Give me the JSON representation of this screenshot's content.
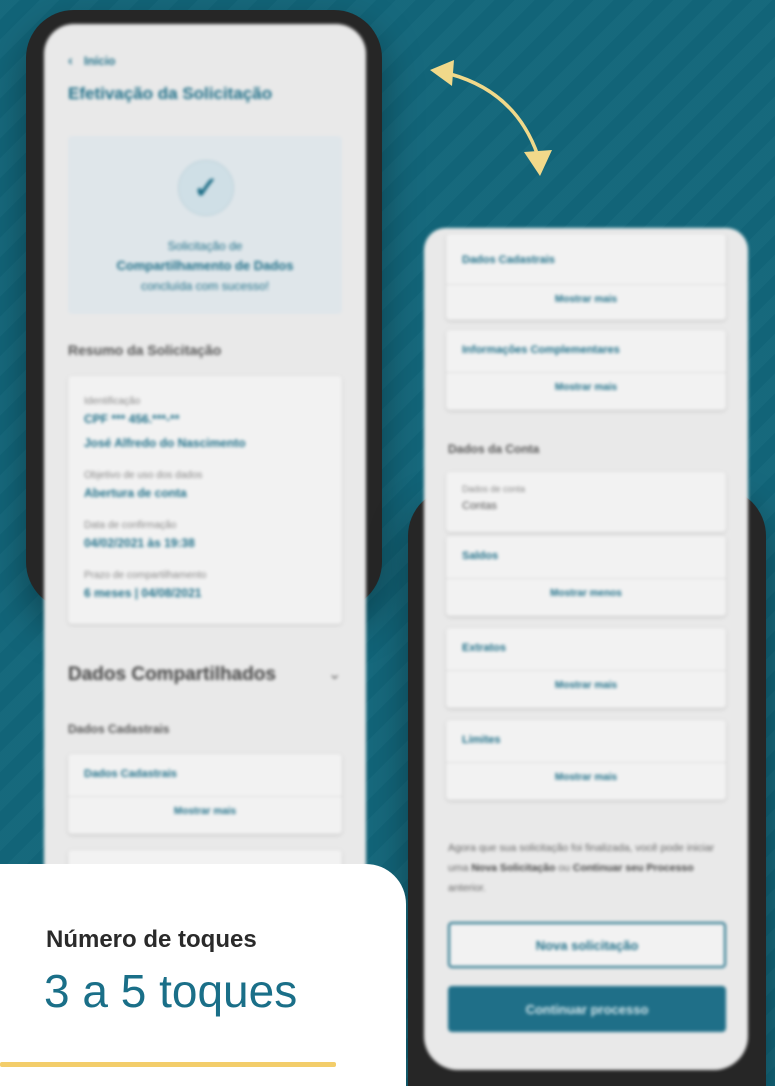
{
  "left_screen": {
    "back_label": "Início",
    "title": "Efetivação da Solicitação",
    "success": {
      "line1": "Solicitação de",
      "line2": "Compartilhamento de Dados",
      "line3": "concluída com sucesso!"
    },
    "summary_heading": "Resumo da Solicitação",
    "summary": [
      {
        "label": "Identificação",
        "value": "CPF *** 456.***-**"
      },
      {
        "label": "",
        "value": "José Alfredo do Nascimento"
      },
      {
        "label": "Objetivo de uso dos dados",
        "value": "Abertura de conta"
      },
      {
        "label": "Data de confirmação",
        "value": "04/02/2021 às 19:38"
      },
      {
        "label": "Prazo de compartilhamento",
        "value": "6 meses | 04/08/2021"
      }
    ],
    "shared_heading": "Dados Compartilhados",
    "sub_heading": "Dados Cadastrais",
    "cards": [
      {
        "title": "Dados Cadastrais",
        "link": "Mostrar mais"
      }
    ]
  },
  "right_screen": {
    "cards_top": [
      {
        "title": "Dados Cadastrais",
        "link": "Mostrar mais"
      },
      {
        "title": "Informações Complementares",
        "link": "Mostrar mais"
      }
    ],
    "account_heading": "Dados da Conta",
    "account": {
      "label": "Dados de conta",
      "value": "Contas"
    },
    "cards_bottom": [
      {
        "title": "Saldos",
        "link": "Mostrar menos"
      },
      {
        "title": "Extratos",
        "link": "Mostrar mais"
      },
      {
        "title": "Limites",
        "link": "Mostrar mais"
      }
    ],
    "message": {
      "prefix": "Agora que sua solicitação foi finalizada, você pode iniciar uma ",
      "new_request": "Nova Solicitação",
      "middle": " ou ",
      "continue": "Continuar seu Processo",
      "suffix": " anterior."
    },
    "btn_new": "Nova solicitação",
    "btn_continue": "Continuar processo"
  },
  "info": {
    "label": "Número de toques",
    "value": "3 a 5 toques"
  },
  "colors": {
    "background": "#12667a",
    "brand": "#1f6f88",
    "accent_line": "#f3cd6a",
    "arrow": "#f1d98a"
  }
}
